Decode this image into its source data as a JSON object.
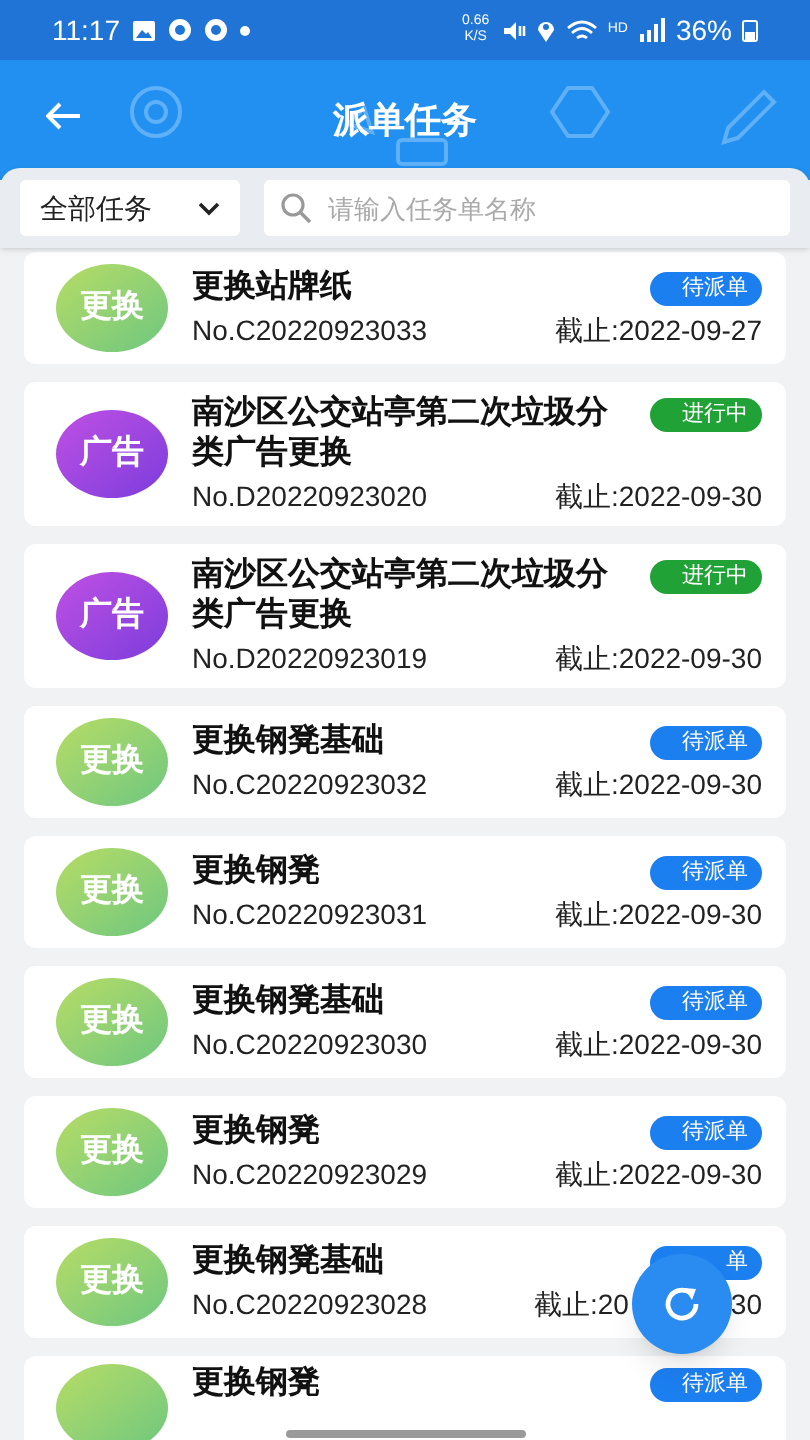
{
  "status_bar": {
    "time": "11:17",
    "speed": "0.66 K/S",
    "hd": "HD",
    "battery": "36%"
  },
  "header": {
    "title": "派单任务"
  },
  "filter": {
    "dropdown": "全部任务",
    "search_placeholder": "请输入任务单名称"
  },
  "tasks": [
    {
      "kind": "replace",
      "avatar": "更换",
      "title": "更换站牌纸",
      "number": "No.C20220923033",
      "color": "#1c7ff0",
      "status": "待派单",
      "deadline": "截止:2022-09-27"
    },
    {
      "kind": "ad",
      "avatar": "广告",
      "title": "南沙区公交站亭第二次垃圾分类广告更换",
      "number": "No.D20220923020",
      "color": "#21a236",
      "status": "进行中",
      "deadline": "截止:2022-09-30"
    },
    {
      "kind": "ad",
      "avatar": "广告",
      "title": "南沙区公交站亭第二次垃圾分类广告更换",
      "number": "No.D20220923019",
      "color": "#21a236",
      "status": "进行中",
      "deadline": "截止:2022-09-30"
    },
    {
      "kind": "replace",
      "avatar": "更换",
      "title": "更换钢凳基础",
      "number": "No.C20220923032",
      "color": "#1c7ff0",
      "status": "待派单",
      "deadline": "截止:2022-09-30"
    },
    {
      "kind": "replace",
      "avatar": "更换",
      "title": "更换钢凳",
      "number": "No.C20220923031",
      "color": "#1c7ff0",
      "status": "待派单",
      "deadline": "截止:2022-09-30"
    },
    {
      "kind": "replace",
      "avatar": "更换",
      "title": "更换钢凳基础",
      "number": "No.C20220923030",
      "color": "#1c7ff0",
      "status": "待派单",
      "deadline": "截止:2022-09-30"
    },
    {
      "kind": "replace",
      "avatar": "更换",
      "title": "更换钢凳",
      "number": "No.C20220923029",
      "color": "#1c7ff0",
      "status": "待派单",
      "deadline": "截止:2022-09-30"
    },
    {
      "kind": "replace",
      "avatar": "更换",
      "title": "更换钢凳基础",
      "number": "No.C20220923028",
      "color": "#1c7ff0",
      "status": "单",
      "deadline": "截止:20",
      "deadline_end": "30"
    },
    {
      "kind": "replace",
      "title": "更换钢凳",
      "color": "#1c7ff0",
      "status": "待派单"
    }
  ]
}
